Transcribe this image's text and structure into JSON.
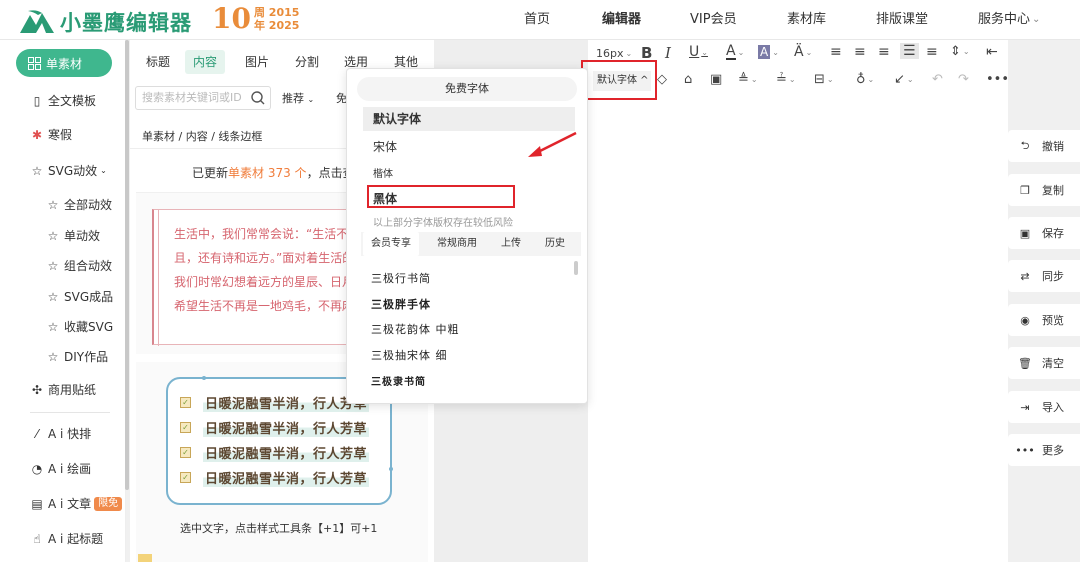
{
  "header": {
    "logo_text": "小墨鹰编辑器",
    "anniversary": {
      "number": "10",
      "line1": "周 2015",
      "line2": "年 2025"
    },
    "nav": [
      {
        "label": "首页"
      },
      {
        "label": "编辑器"
      },
      {
        "label": "VIP会员"
      },
      {
        "label": "素材库"
      },
      {
        "label": "排版课堂"
      },
      {
        "label": "服务中心"
      }
    ],
    "nav_dropdown": "⌄"
  },
  "sidebar": {
    "active": "单素材",
    "items": [
      {
        "label": "全文模板"
      },
      {
        "label": "寒假"
      },
      {
        "label": "SVG动效"
      },
      {
        "label": "全部动效"
      },
      {
        "label": "单动效"
      },
      {
        "label": "组合动效"
      },
      {
        "label": "SVG成品"
      },
      {
        "label": "收藏SVG"
      },
      {
        "label": "DIY作品"
      },
      {
        "label": "商用贴纸"
      },
      {
        "label": "A i 快排"
      },
      {
        "label": "A i 绘画"
      },
      {
        "label": "A i 文章"
      },
      {
        "label": "A i 起标题"
      }
    ],
    "badge": "限免"
  },
  "panel": {
    "tabs": [
      {
        "label": "标题"
      },
      {
        "label": "内容"
      },
      {
        "label": "图片"
      },
      {
        "label": "分割"
      },
      {
        "label": "选用"
      },
      {
        "label": "其他"
      }
    ],
    "search_placeholder": "搜索素材关键词或ID",
    "sort_label": "推荐",
    "sort2_label": "免",
    "breadcrumb": "单素材 / 内容 / 线条边框",
    "updated_prefix": "已更新",
    "updated_highlight": "单素材 373 个",
    "updated_suffix": "，点击查",
    "card1_text": "生活中，我们常常会说：“生活不止眼前的苟且，还有诗和远方。”面对着生活的一地鸡毛，我们时常幻想着远方的星辰、日月、天和影，希望生活不再是一地鸡毛，不再麻。",
    "card2_lines": [
      "日暖泥融雪半消，行人芳草",
      "日暖泥融雪半消，行人芳草",
      "日暖泥融雪半消，行人芳草",
      "日暖泥融雪半消，行人芳草"
    ],
    "card2_footer": "选中文字，点击样式工具条【+1】可+1"
  },
  "toolbar": {
    "font_size": "16px",
    "font_family": "默认字体 ^"
  },
  "actions": [
    {
      "label": "撤销"
    },
    {
      "label": "复制"
    },
    {
      "label": "保存"
    },
    {
      "label": "同步"
    },
    {
      "label": "预览"
    },
    {
      "label": "清空"
    },
    {
      "label": "导入"
    },
    {
      "label": "更多"
    }
  ],
  "font_dropdown": {
    "free_label": "免费字体",
    "default_label": "默认字体",
    "items": [
      "宋体",
      "楷体",
      "黑体"
    ],
    "note": "以上部分字体版权存在较低风险",
    "tabs": [
      "会员专享",
      "常规商用",
      "上传",
      "历史"
    ],
    "fonts": [
      "三极行书简",
      "三极胖手体",
      "三极花韵体 中粗",
      "三极抽宋体 细",
      "三极隶书简"
    ]
  },
  "colors": {
    "brand": "#3fb78e",
    "highlight": "#e0242b",
    "accent_orange": "#f07c3a"
  }
}
